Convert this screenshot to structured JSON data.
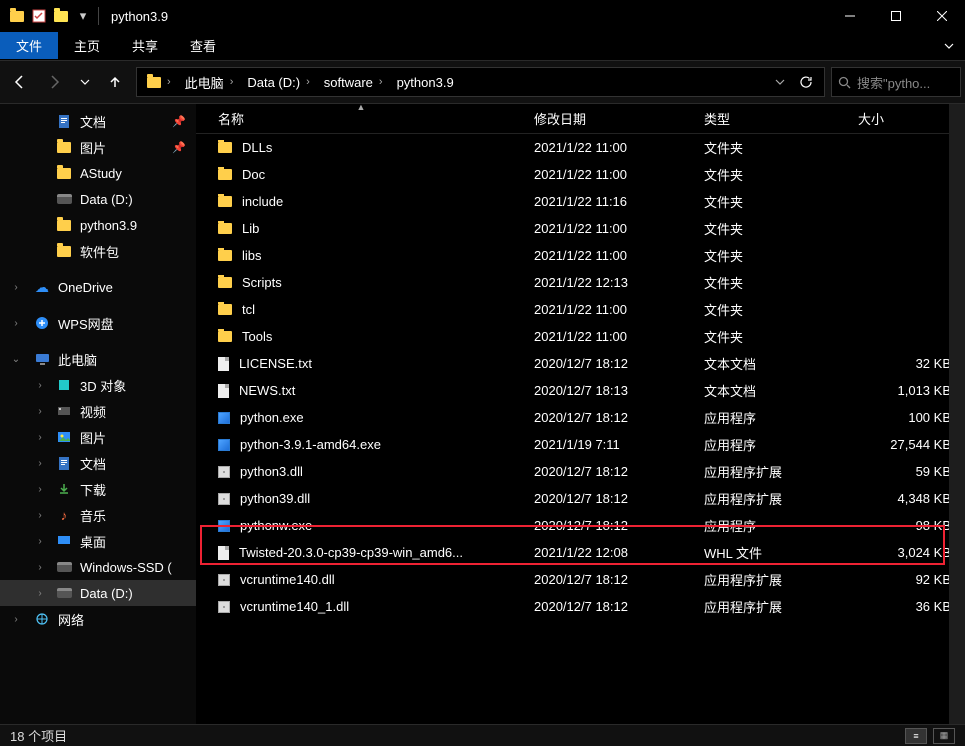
{
  "window": {
    "title": "python3.9",
    "min": "—",
    "max": "▢",
    "close": "✕"
  },
  "ribbon": {
    "file": "文件",
    "home": "主页",
    "share": "共享",
    "view": "查看"
  },
  "breadcrumb": {
    "root": "此电脑",
    "drive": "Data (D:)",
    "seg1": "software",
    "seg2": "python3.9"
  },
  "search": {
    "placeholder": "搜索\"pytho..."
  },
  "sidebar": {
    "items": [
      {
        "label": "文档",
        "icon": "doc",
        "pin": true,
        "indent": 2
      },
      {
        "label": "图片",
        "icon": "folder",
        "pin": true,
        "indent": 2
      },
      {
        "label": "AStudy",
        "icon": "folder",
        "pin": false,
        "indent": 2
      },
      {
        "label": "Data (D:)",
        "icon": "drive",
        "pin": false,
        "indent": 2
      },
      {
        "label": "python3.9",
        "icon": "folder",
        "pin": false,
        "indent": 2
      },
      {
        "label": "软件包",
        "icon": "folder",
        "pin": false,
        "indent": 2
      },
      {
        "gap": true
      },
      {
        "label": "OneDrive",
        "icon": "cloud",
        "pin": false,
        "indent": 1,
        "exp": ">"
      },
      {
        "gap": true
      },
      {
        "label": "WPS网盘",
        "icon": "cloud2",
        "pin": false,
        "indent": 1,
        "exp": ">"
      },
      {
        "gap": true
      },
      {
        "label": "此电脑",
        "icon": "pc",
        "pin": false,
        "indent": 1,
        "exp": "v"
      },
      {
        "label": "3D 对象",
        "icon": "3d",
        "pin": false,
        "indent": 2,
        "exp": ">"
      },
      {
        "label": "视频",
        "icon": "video",
        "pin": false,
        "indent": 2,
        "exp": ">"
      },
      {
        "label": "图片",
        "icon": "pic",
        "pin": false,
        "indent": 2,
        "exp": ">"
      },
      {
        "label": "文档",
        "icon": "doc",
        "pin": false,
        "indent": 2,
        "exp": ">"
      },
      {
        "label": "下载",
        "icon": "dl",
        "pin": false,
        "indent": 2,
        "exp": ">"
      },
      {
        "label": "音乐",
        "icon": "music",
        "pin": false,
        "indent": 2,
        "exp": ">"
      },
      {
        "label": "桌面",
        "icon": "desk",
        "pin": false,
        "indent": 2,
        "exp": ">"
      },
      {
        "label": "Windows-SSD (",
        "icon": "drive",
        "pin": false,
        "indent": 2,
        "exp": ">"
      },
      {
        "label": "Data (D:)",
        "icon": "drive",
        "pin": false,
        "indent": 2,
        "exp": ">",
        "selected": true
      },
      {
        "label": "网络",
        "icon": "net",
        "pin": false,
        "indent": 1,
        "exp": ">"
      }
    ]
  },
  "columns": {
    "name": "名称",
    "date": "修改日期",
    "type": "类型",
    "size": "大小"
  },
  "files": [
    {
      "name": "DLLs",
      "date": "2021/1/22 11:00",
      "type": "文件夹",
      "size": "",
      "icon": "folder"
    },
    {
      "name": "Doc",
      "date": "2021/1/22 11:00",
      "type": "文件夹",
      "size": "",
      "icon": "folder"
    },
    {
      "name": "include",
      "date": "2021/1/22 11:16",
      "type": "文件夹",
      "size": "",
      "icon": "folder"
    },
    {
      "name": "Lib",
      "date": "2021/1/22 11:00",
      "type": "文件夹",
      "size": "",
      "icon": "folder"
    },
    {
      "name": "libs",
      "date": "2021/1/22 11:00",
      "type": "文件夹",
      "size": "",
      "icon": "folder"
    },
    {
      "name": "Scripts",
      "date": "2021/1/22 12:13",
      "type": "文件夹",
      "size": "",
      "icon": "folder"
    },
    {
      "name": "tcl",
      "date": "2021/1/22 11:00",
      "type": "文件夹",
      "size": "",
      "icon": "folder"
    },
    {
      "name": "Tools",
      "date": "2021/1/22 11:00",
      "type": "文件夹",
      "size": "",
      "icon": "folder"
    },
    {
      "name": "LICENSE.txt",
      "date": "2020/12/7 18:12",
      "type": "文本文档",
      "size": "32 KB",
      "icon": "doc"
    },
    {
      "name": "NEWS.txt",
      "date": "2020/12/7 18:13",
      "type": "文本文档",
      "size": "1,013 KB",
      "icon": "doc"
    },
    {
      "name": "python.exe",
      "date": "2020/12/7 18:12",
      "type": "应用程序",
      "size": "100 KB",
      "icon": "exe"
    },
    {
      "name": "python-3.9.1-amd64.exe",
      "date": "2021/1/19 7:11",
      "type": "应用程序",
      "size": "27,544 KB",
      "icon": "exe"
    },
    {
      "name": "python3.dll",
      "date": "2020/12/7 18:12",
      "type": "应用程序扩展",
      "size": "59 KB",
      "icon": "dll"
    },
    {
      "name": "python39.dll",
      "date": "2020/12/7 18:12",
      "type": "应用程序扩展",
      "size": "4,348 KB",
      "icon": "dll"
    },
    {
      "name": "pythonw.exe",
      "date": "2020/12/7 18:12",
      "type": "应用程序",
      "size": "98 KB",
      "icon": "exe"
    },
    {
      "name": "Twisted-20.3.0-cp39-cp39-win_amd6...",
      "date": "2021/1/22 12:08",
      "type": "WHL 文件",
      "size": "3,024 KB",
      "icon": "doc",
      "highlight": true
    },
    {
      "name": "vcruntime140.dll",
      "date": "2020/12/7 18:12",
      "type": "应用程序扩展",
      "size": "92 KB",
      "icon": "dll"
    },
    {
      "name": "vcruntime140_1.dll",
      "date": "2020/12/7 18:12",
      "type": "应用程序扩展",
      "size": "36 KB",
      "icon": "dll"
    }
  ],
  "status": {
    "count": "18 个项目"
  }
}
